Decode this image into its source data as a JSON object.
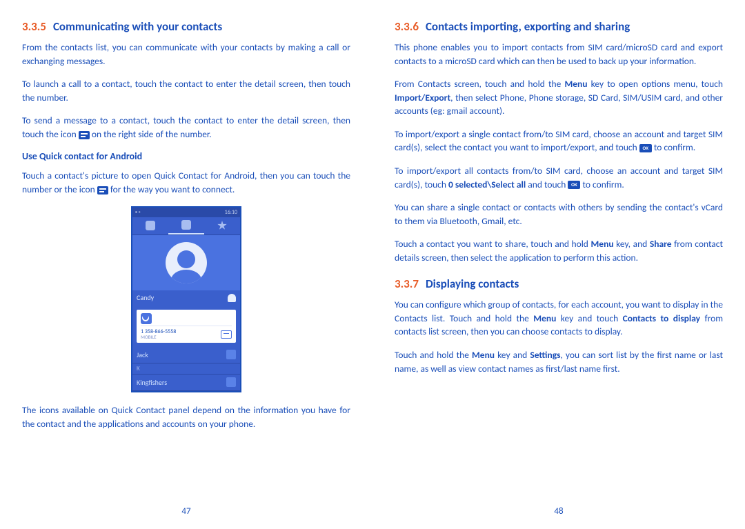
{
  "left": {
    "sec_num": "3.3.5",
    "title": "Communicating with your contacts",
    "p1": "From the contacts list, you can communicate with your contacts by making a call or exchanging messages.",
    "p2": "To launch a call to a contact, touch the contact to enter the detail screen, then touch the number.",
    "p3a": "To send a message to a contact, touch the contact to enter the detail screen, then touch the icon ",
    "p3b": " on the right side of the number.",
    "h3": "Use Quick contact for Android",
    "p4a": "Touch a contact's picture to open Quick Contact for Android, then you can touch the number or the icon ",
    "p4b": " for the way you want to connect.",
    "p5": "The icons available on Quick Contact panel depend on the information you have for the contact and the applications and accounts on your phone.",
    "pagenum": "47",
    "screenshot": {
      "time": "16:10",
      "contact_name": "Candy",
      "phone_number": "1 358-866-5558",
      "phone_label": "MOBILE",
      "row1": "Jack",
      "letter": "K",
      "row2": "Kingfishers"
    }
  },
  "right": {
    "sec1_num": "3.3.6",
    "sec1_title": "Contacts importing, exporting and sharing",
    "p1": "This phone enables you to import contacts from SIM card/microSD card and export contacts to a microSD card which can then be used to back up your information.",
    "p2a": "From Contacts screen, touch and hold the ",
    "p2b": " key to open options menu, touch ",
    "p2c": ", then select Phone, Phone storage, SD Card, SIM/USIM card, and other accounts (eg: gmail account).",
    "bold_menu": "Menu",
    "bold_ie": "Import/Export",
    "p3a": "To import/export a single contact from/to SIM card, choose an account and target SIM card(s), select the contact you want to import/export, and touch ",
    "p3b": " to confirm.",
    "p4a": "To import/export all contacts from/to SIM card, choose an account and target SIM card(s), touch ",
    "p4b": " and touch ",
    "p4c": " to confirm.",
    "bold_select": "0 selected\\Select all",
    "p5": "You can share a single contact or contacts with others by sending the contact's vCard to them via Bluetooth, Gmail, etc.",
    "p6a": "Touch a contact you want to share, touch and hold ",
    "p6b": " key, and ",
    "p6c": " from contact details screen, then select the application to perform this action.",
    "bold_share": "Share",
    "sec2_num": "3.3.7",
    "sec2_title": "Displaying contacts",
    "p7a": "You can configure which group of contacts, for each account, you want to display in the Contacts list. Touch and hold the ",
    "p7b": " key and touch ",
    "p7c": " from contacts list screen, then you can choose contacts to display.",
    "bold_ctd": "Contacts to display",
    "p8a": "Touch and hold the ",
    "p8b": " key and ",
    "p8c": ", you can sort list by the first name or last name, as well as view contact names as first/last name first.",
    "bold_settings": "Settings",
    "pagenum": "48",
    "ok_label": "OK"
  }
}
